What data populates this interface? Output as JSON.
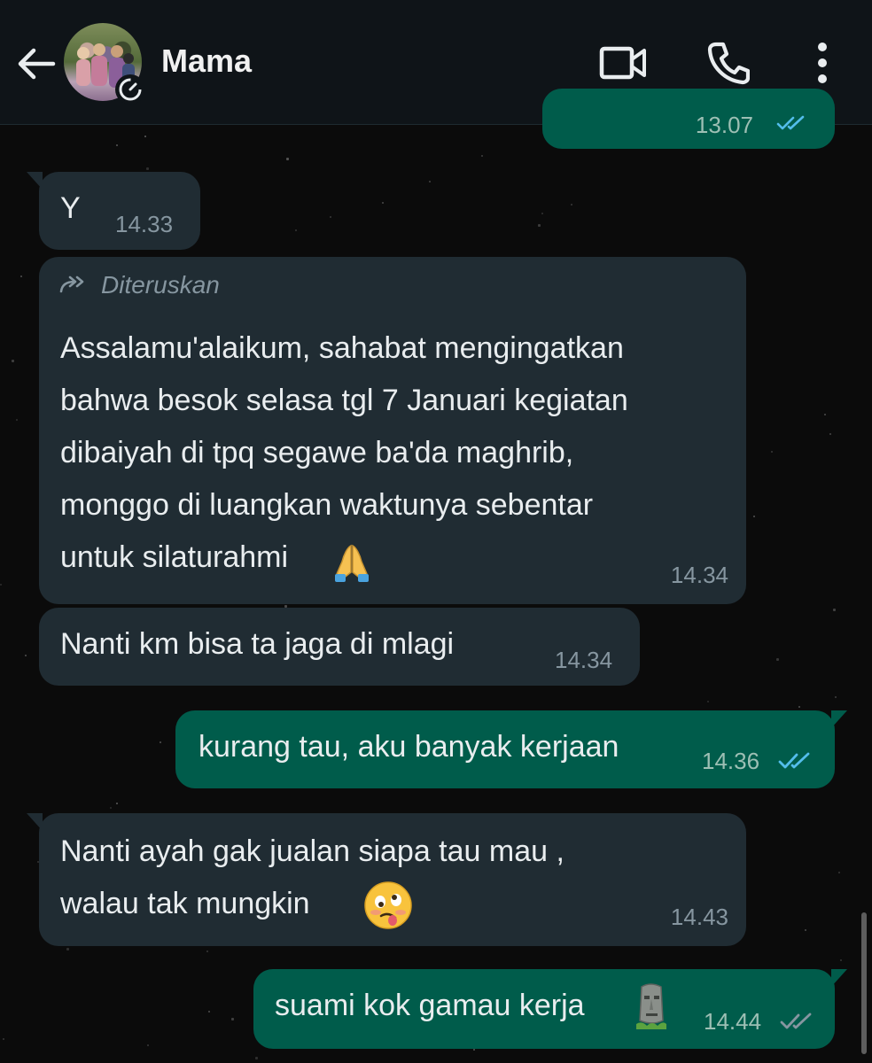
{
  "header": {
    "contact_name": "Mama"
  },
  "messages": [
    {
      "direction": "outgoing",
      "text": "",
      "time": "13.07"
    },
    {
      "direction": "incoming",
      "text": "Y",
      "time": "14.33"
    },
    {
      "direction": "incoming",
      "forwarded_label": "Diteruskan",
      "lines": [
        "Assalamu'alaikum, sahabat mengingatkan",
        "bahwa besok selasa tgl 7 Januari kegiatan",
        "dibaiyah di tpq segawe ba'da maghrib,",
        "monggo di luangkan waktunya sebentar",
        "untuk silaturahmi"
      ],
      "time": "14.34"
    },
    {
      "direction": "incoming",
      "text": "Nanti km bisa ta jaga di mlagi",
      "time": "14.34"
    },
    {
      "direction": "outgoing",
      "text": "kurang tau, aku banyak kerjaan",
      "time": "14.36",
      "ticks": "read"
    },
    {
      "direction": "incoming",
      "lines": [
        "Nanti ayah gak jualan siapa tau mau ,",
        "walau tak mungkin"
      ],
      "time": "14.43"
    },
    {
      "direction": "outgoing",
      "text": "suami kok gamau kerja",
      "time": "14.44",
      "ticks": "delivered"
    }
  ],
  "icons": {
    "back": "arrow-left-icon",
    "video": "video-call-icon",
    "phone": "phone-call-icon",
    "menu": "more-vert-icon"
  },
  "colors": {
    "header_bg": "#0f1418",
    "incoming_bubble": "#202c33",
    "outgoing_bubble": "#005c4b",
    "read_tick": "#53bdeb",
    "delivered_tick": "#8696a0"
  }
}
